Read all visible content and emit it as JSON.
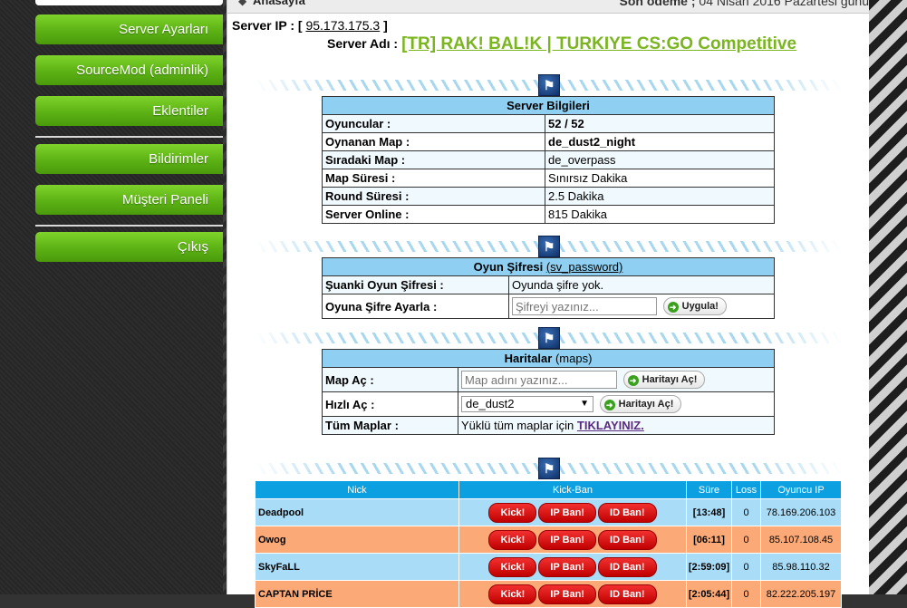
{
  "sidebar": {
    "items": [
      {
        "label": "Server Ayarları"
      },
      {
        "label": "SourceMod (adminlik)"
      },
      {
        "label": "Eklentiler"
      },
      {
        "label": "Bildirimler"
      },
      {
        "label": "Müşteri Paneli"
      },
      {
        "label": "Çıkış"
      }
    ]
  },
  "header": {
    "home_label": "Anasayfa",
    "last_payment_label": "Son ödeme ;",
    "last_payment_value": "04 Nisan 2016 Pazartesi günü"
  },
  "server": {
    "ip_label": "Server IP : [",
    "ip_value": "95.173.175.3",
    "ip_close": "]",
    "name_label": "Server Adı :",
    "name_value": "[TR] RAK! BAL!K | TURKIYE CS:GO Competitive"
  },
  "info_table": {
    "title": "Server Bilgileri",
    "rows": [
      {
        "label": "Oyuncular :",
        "value": "52 / 52"
      },
      {
        "label": "Oynanan Map :",
        "value": "de_dust2_night"
      },
      {
        "label": "Sıradaki Map :",
        "value": "de_overpass"
      },
      {
        "label": "Map Süresi :",
        "value": "Sınırsız Dakika"
      },
      {
        "label": "Round Süresi :",
        "value": "2.5 Dakika"
      },
      {
        "label": "Server Online :",
        "value": "815 Dakika"
      }
    ]
  },
  "password_table": {
    "title": "Oyun Şifresi",
    "title_link": "(sv_password)",
    "current_label": "Şuanki Oyun Şifresi :",
    "current_value": "Oyunda şifre yok.",
    "set_label": "Oyuna Şifre Ayarla :",
    "set_placeholder": "Şifreyi yazınız...",
    "set_button": "Uygula!"
  },
  "maps_table": {
    "title": "Haritalar",
    "title_sub": "(maps)",
    "open_label": "Map Aç :",
    "open_placeholder": "Map adını yazınız...",
    "open_button": "Haritayı Aç!",
    "quick_label": "Hızlı Aç :",
    "quick_selected": "de_dust2",
    "quick_button": "Haritayı Aç!",
    "all_label": "Tüm Maplar :",
    "all_text": "Yüklü tüm maplar için",
    "all_link": "TIKLAYINIZ."
  },
  "players": {
    "headers": [
      "Nick",
      "Kick-Ban",
      "Süre",
      "Loss",
      "Oyuncu IP"
    ],
    "kick_label": "Kick!",
    "ipban_label": "IP Ban!",
    "idban_label": "ID Ban!",
    "rows": [
      {
        "nick": "Deadpool",
        "time": "[13:48]",
        "loss": "0",
        "ip": "78.169.206.103"
      },
      {
        "nick": "Owog",
        "time": "[06:11]",
        "loss": "0",
        "ip": "85.107.108.45"
      },
      {
        "nick": "SkyFaLL",
        "time": "[2:59:09]",
        "loss": "0",
        "ip": "85.98.110.32"
      },
      {
        "nick": "CAPTAN PRİCE",
        "time": "[2:05:44]",
        "loss": "0",
        "ip": "82.222.205.197"
      }
    ]
  },
  "colors": {
    "accent_green": "#7ab520",
    "header_blue": "#8fd0f2",
    "player_header": "#0ca0e0",
    "row_blue": "#a9dcf7",
    "row_orange": "#fbaa77",
    "kick_red": "#e01010"
  },
  "icons": {
    "divider_logo": "counter-strike-icon",
    "button_arrow": "arrow-right-icon",
    "home": "home-icon"
  }
}
